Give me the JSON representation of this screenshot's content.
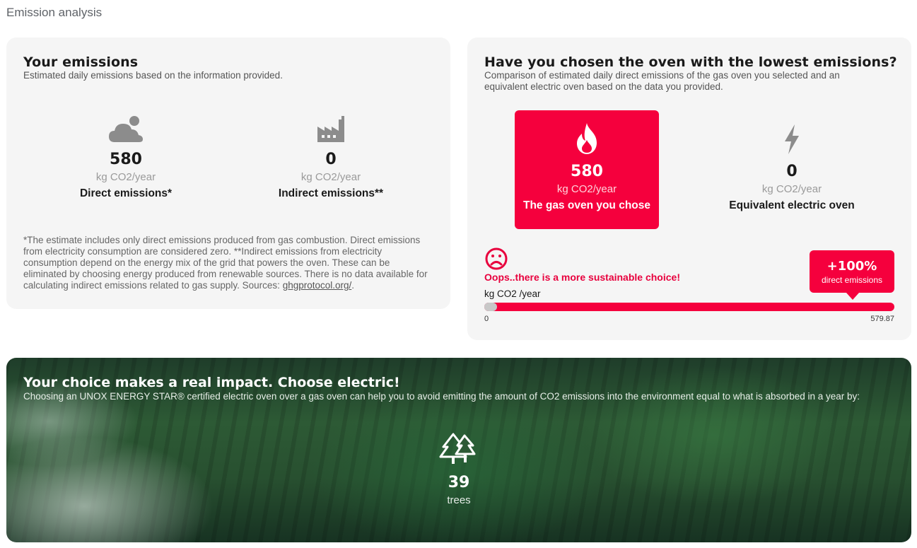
{
  "page": {
    "title": "Emission analysis"
  },
  "your_emissions": {
    "title": "Your emissions",
    "subtitle": "Estimated daily emissions based on the information provided.",
    "direct": {
      "icon": "cloud-icon",
      "value": "580",
      "unit": "kg CO2/year",
      "label": "Direct emissions*"
    },
    "indirect": {
      "icon": "factory-icon",
      "value": "0",
      "unit": "kg CO2/year",
      "label": "Indirect emissions**"
    },
    "footnote": "*The estimate includes only direct emissions produced from gas combustion. Direct emissions from electricity consumption are considered zero. **Indirect emissions from electricity consumption depend on the energy mix of the grid that powers the oven. These can be eliminated by choosing energy produced from renewable sources. There is no data available for calculating indirect emissions related to gas supply. Sources: ",
    "footnote_link": "ghgprotocol.org/",
    "footnote_end": "."
  },
  "comparison": {
    "title": "Have you chosen the oven with the lowest emissions?",
    "subtitle": "Comparison of estimated daily direct emissions of the gas oven you selected and an equivalent electric oven based on the data you provided.",
    "gas": {
      "icon": "flame-icon",
      "value": "580",
      "unit": "kg CO2/year",
      "label": "The gas oven you chose"
    },
    "electric": {
      "icon": "lightning-icon",
      "value": "0",
      "unit": "kg CO2/year",
      "label": "Equivalent electric oven"
    },
    "verdict": {
      "icon": "sad-face-icon",
      "text": "Oops..there is a more sustainable choice!"
    },
    "bar": {
      "label": "kg CO2 /year",
      "min": "0",
      "max": "579.87",
      "fill_fraction": 1.0
    },
    "badge": {
      "value": "+100%",
      "label": "direct emissions"
    }
  },
  "impact": {
    "title": "Your choice makes a real impact. Choose electric!",
    "subtitle": "Choosing an UNOX ENERGY STAR® certified electric oven over a gas oven can help you to avoid emitting the amount of CO2 emissions into the environment equal to what is absorbed in a year by:",
    "icon": "trees-icon",
    "value": "39",
    "unit": "trees"
  },
  "colors": {
    "accent": "#f5003d",
    "card_bg": "#f5f5f5",
    "muted": "#9a9a9a"
  }
}
